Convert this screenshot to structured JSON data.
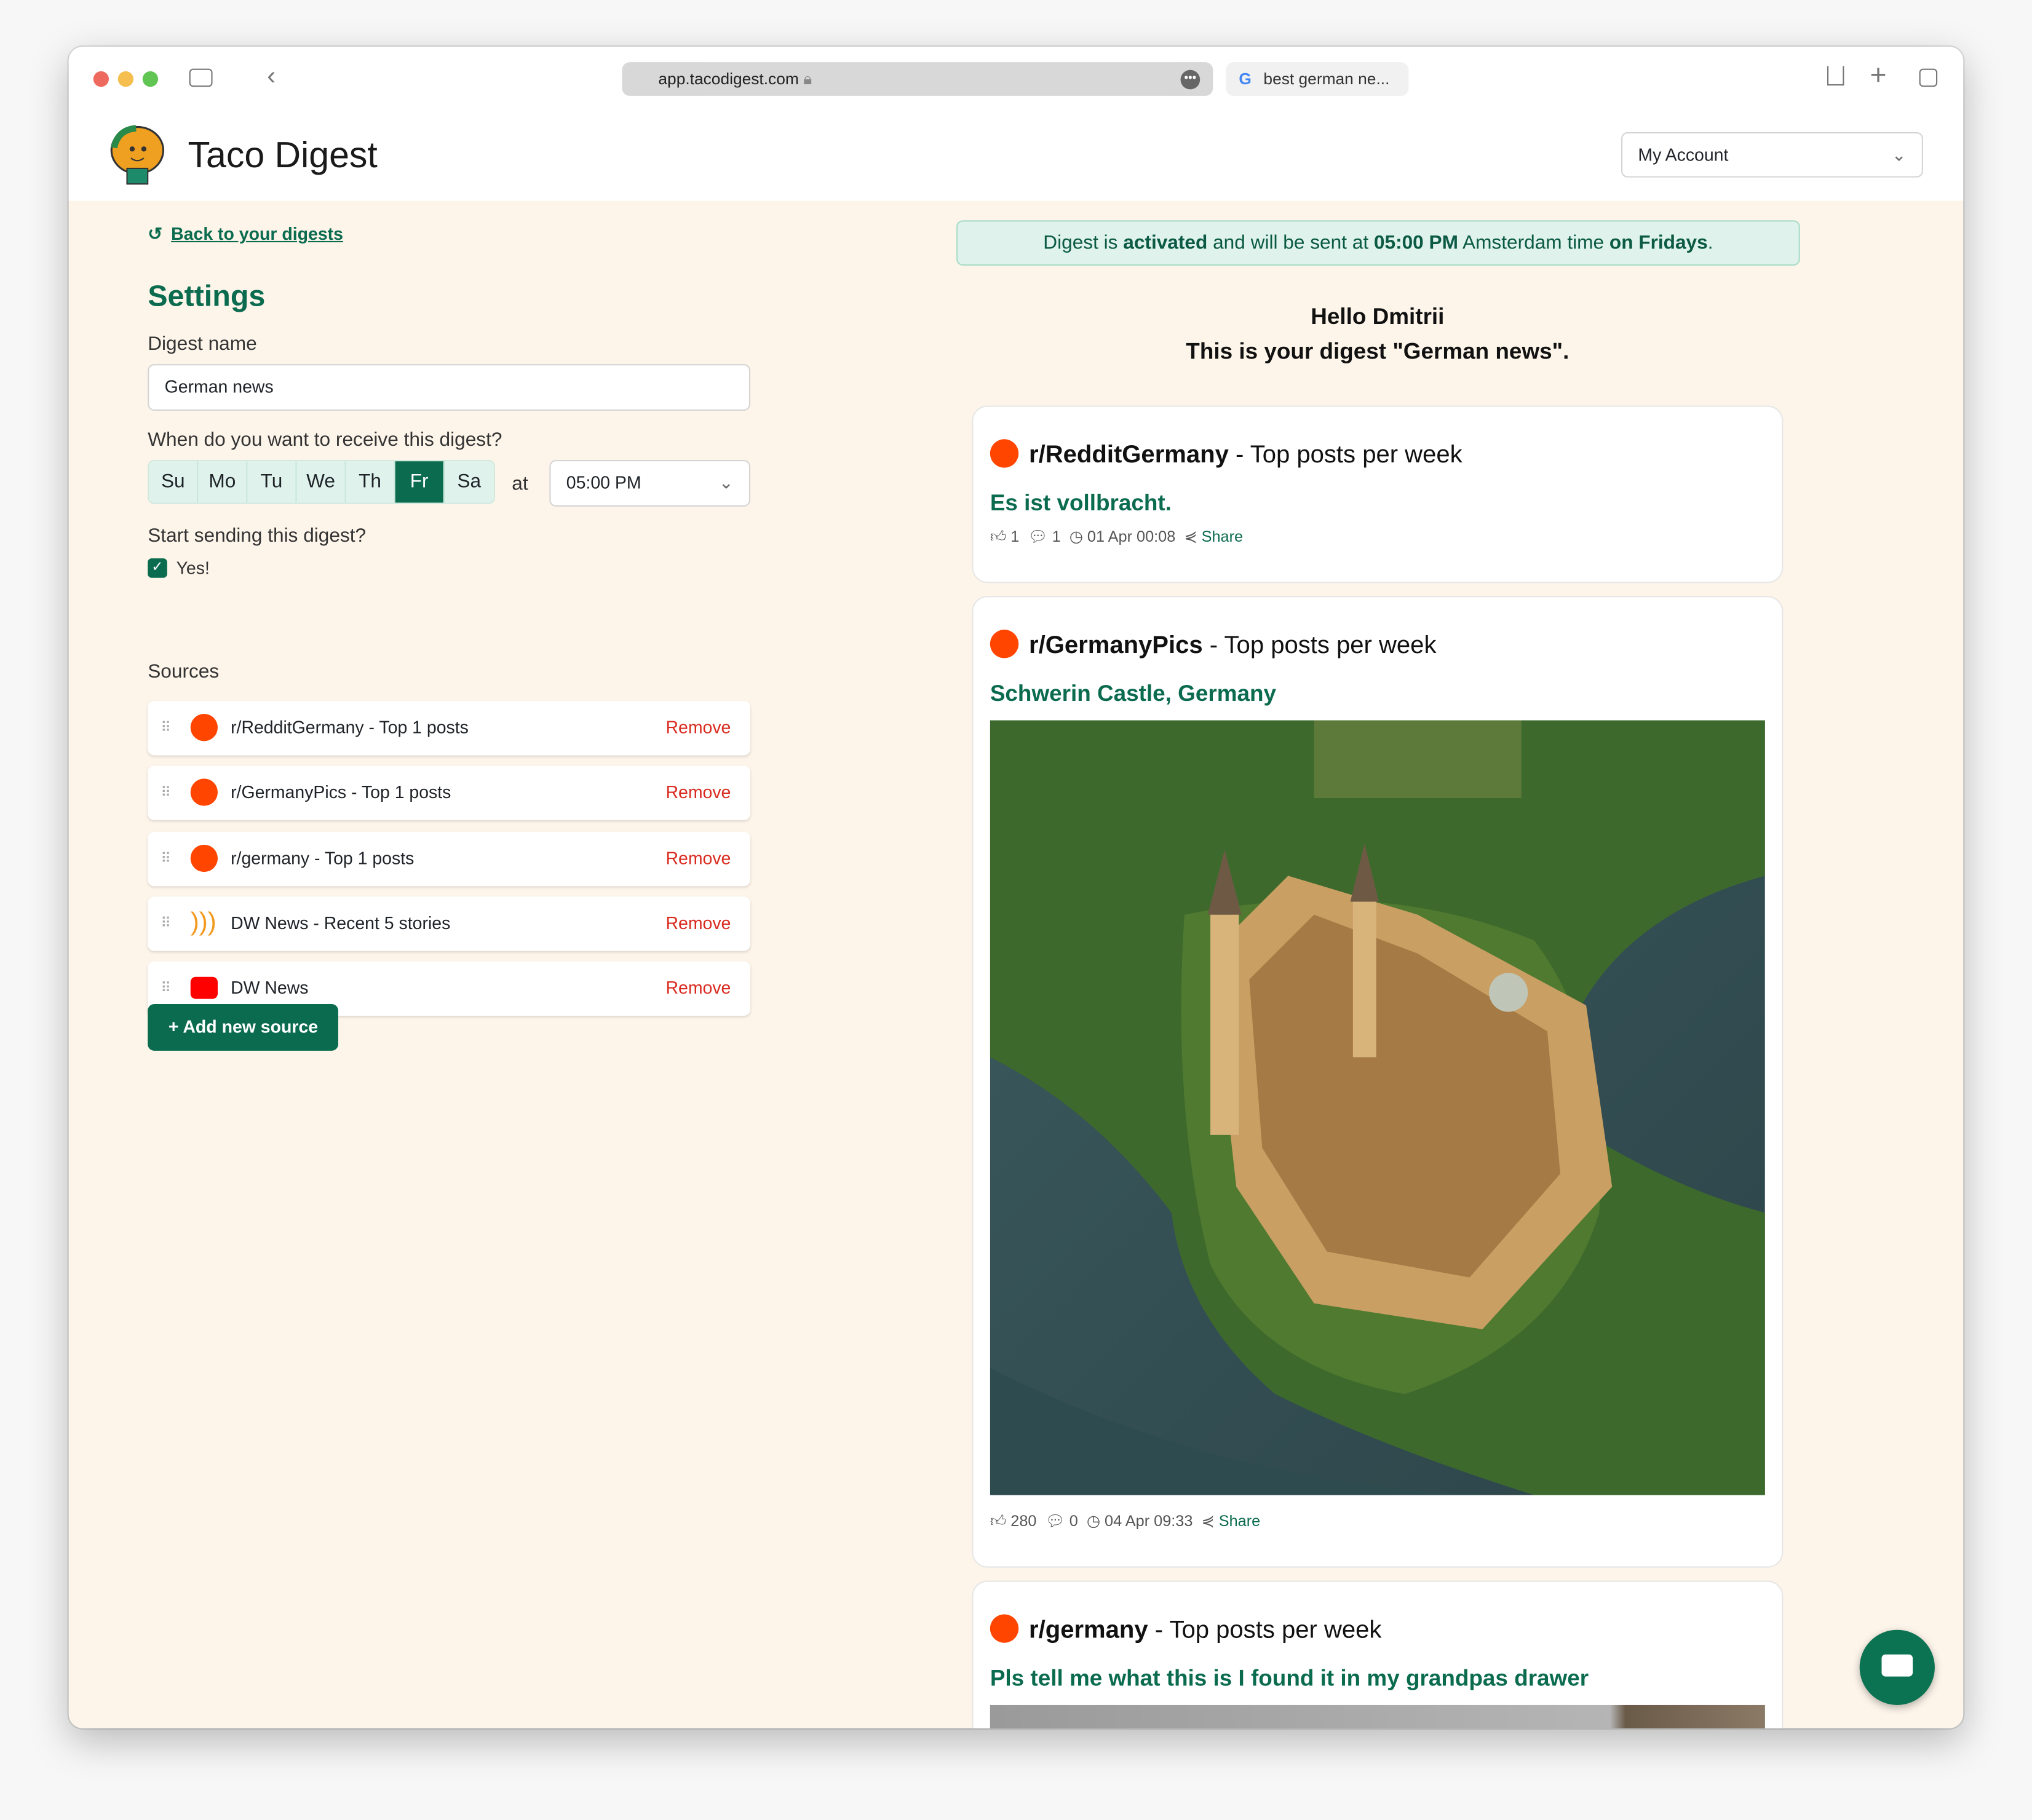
{
  "browser": {
    "url": "app.tacodigest.com",
    "tab2": "best german ne..."
  },
  "header": {
    "title": "Taco Digest",
    "account": "My Account"
  },
  "settings": {
    "back": "Back to your digests",
    "title": "Settings",
    "name_label": "Digest name",
    "name_value": "German news",
    "when_label": "When do you want to receive this digest?",
    "days": [
      "Su",
      "Mo",
      "Tu",
      "We",
      "Th",
      "Fr",
      "Sa"
    ],
    "selected_day": "Fr",
    "at": "at",
    "time": "05:00 PM",
    "start_label": "Start sending this digest?",
    "start_check": "Yes!",
    "sources_label": "Sources",
    "sources": [
      {
        "name": "r/RedditGermany - Top 1 posts",
        "type": "reddit"
      },
      {
        "name": "r/GermanyPics - Top 1 posts",
        "type": "reddit"
      },
      {
        "name": "r/germany - Top 1 posts",
        "type": "reddit"
      },
      {
        "name": "DW News - Recent 5 stories",
        "type": "rss"
      },
      {
        "name": "DW News",
        "type": "youtube"
      }
    ],
    "remove": "Remove",
    "add": "+ Add new source"
  },
  "banner": {
    "a": "Digest is ",
    "b": "activated",
    "c": " and will be sent at ",
    "d": "05:00 PM",
    "e": " Amsterdam time ",
    "f": "on Fridays",
    "g": "."
  },
  "greeting": {
    "hello": "Hello Dmitrii",
    "line": "This is your digest \"German news\"."
  },
  "cards": [
    {
      "sub": "r/RedditGermany",
      "suffix": " - Top posts per week",
      "post": "Es ist vollbracht.",
      "likes": "1",
      "comments": "1",
      "time": "01 Apr 00:08",
      "share": "Share"
    },
    {
      "sub": "r/GermanyPics",
      "suffix": " - Top posts per week",
      "post": "Schwerin Castle, Germany",
      "likes": "280",
      "comments": "0",
      "time": "04 Apr 09:33",
      "share": "Share"
    },
    {
      "sub": "r/germany",
      "suffix": " - Top posts per week",
      "post": "Pls tell me what this is I found it in my grandpas drawer"
    }
  ],
  "colors": {
    "accent": "#0b6b4f",
    "reddit": "#ff4500",
    "remove": "#d92b1f",
    "background": "#fdf5ea"
  }
}
